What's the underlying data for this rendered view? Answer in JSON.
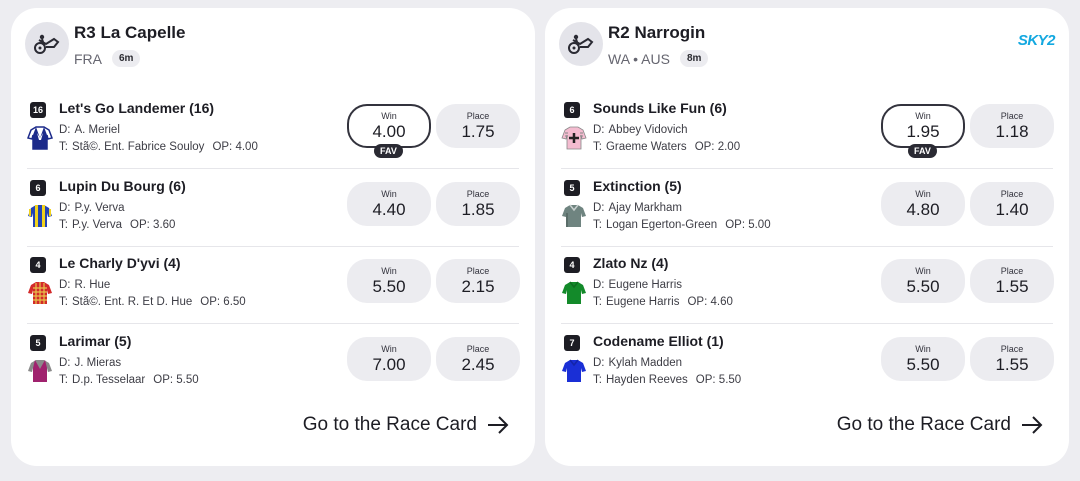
{
  "races": [
    {
      "title": "R3 La Capelle",
      "location": "FRA",
      "time_badge": "6m",
      "race_type_icon": "harness-racing-icon",
      "runners": [
        {
          "number": "16",
          "name": "Let's Go Landemer (16)",
          "driver_label": "D:",
          "driver": "A. Meriel",
          "trainer_label": "T:",
          "trainer": "Stã©. Ent. Fabrice Souloy",
          "op_label": "OP:",
          "op": "4.00",
          "win_label": "Win",
          "win": "4.00",
          "place_label": "Place",
          "place": "1.75",
          "favourite": true,
          "fav_label": "FAV",
          "silk_colors": [
            "#ffffff",
            "#1c2a8a"
          ]
        },
        {
          "number": "6",
          "name": "Lupin Du Bourg (6)",
          "driver_label": "D:",
          "driver": "P.y. Verva",
          "trainer_label": "T:",
          "trainer": "P.y. Verva",
          "op_label": "OP:",
          "op": "3.60",
          "win_label": "Win",
          "win": "4.40",
          "place_label": "Place",
          "place": "1.85",
          "favourite": false,
          "silk_colors": [
            "#2344b5",
            "#f1d21c"
          ]
        },
        {
          "number": "4",
          "name": "Le Charly D'yvi (4)",
          "driver_label": "D:",
          "driver": "R. Hue",
          "trainer_label": "T:",
          "trainer": "Stã©. Ent. R. Et D. Hue",
          "op_label": "OP:",
          "op": "6.50",
          "win_label": "Win",
          "win": "5.50",
          "place_label": "Place",
          "place": "2.15",
          "favourite": false,
          "silk_colors": [
            "#d32a2a",
            "#e7c34a"
          ]
        },
        {
          "number": "5",
          "name": "Larimar (5)",
          "driver_label": "D:",
          "driver": "J. Mieras",
          "trainer_label": "T:",
          "trainer": "D.p. Tesselaar",
          "op_label": "OP:",
          "op": "5.50",
          "win_label": "Win",
          "win": "7.00",
          "place_label": "Place",
          "place": "2.45",
          "favourite": false,
          "silk_colors": [
            "#8a8a8a",
            "#a0226e"
          ]
        }
      ],
      "race_card_link": "Go to the Race Card"
    },
    {
      "title": "R2 Narrogin",
      "location": "WA • AUS",
      "time_badge": "8m",
      "race_type_icon": "harness-racing-icon",
      "broadcaster": "SKY2",
      "runners": [
        {
          "number": "6",
          "name": "Sounds Like Fun (6)",
          "driver_label": "D:",
          "driver": "Abbey Vidovich",
          "trainer_label": "T:",
          "trainer": "Graeme Waters",
          "op_label": "OP:",
          "op": "2.00",
          "win_label": "Win",
          "win": "1.95",
          "place_label": "Place",
          "place": "1.18",
          "favourite": true,
          "fav_label": "FAV",
          "silk_colors": [
            "#f4bcd0",
            "#222222"
          ]
        },
        {
          "number": "5",
          "name": "Extinction (5)",
          "driver_label": "D:",
          "driver": "Ajay Markham",
          "trainer_label": "T:",
          "trainer": "Logan Egerton-Green",
          "op_label": "OP:",
          "op": "5.00",
          "win_label": "Win",
          "win": "4.80",
          "place_label": "Place",
          "place": "1.40",
          "favourite": false,
          "silk_colors": [
            "#6f8480",
            "#5a6d69"
          ]
        },
        {
          "number": "4",
          "name": "Zlato Nz (4)",
          "driver_label": "D:",
          "driver": "Eugene Harris",
          "trainer_label": "T:",
          "trainer": "Eugene Harris",
          "op_label": "OP:",
          "op": "4.60",
          "win_label": "Win",
          "win": "5.50",
          "place_label": "Place",
          "place": "1.55",
          "favourite": false,
          "silk_colors": [
            "#138a2a",
            "#0f6d21"
          ]
        },
        {
          "number": "7",
          "name": "Codename Elliot (1)",
          "driver_label": "D:",
          "driver": "Kylah Madden",
          "trainer_label": "T:",
          "trainer": "Hayden Reeves",
          "op_label": "OP:",
          "op": "5.50",
          "win_label": "Win",
          "win": "5.50",
          "place_label": "Place",
          "place": "1.55",
          "favourite": false,
          "silk_colors": [
            "#1a2fd6",
            "#1424a8"
          ]
        }
      ],
      "race_card_link": "Go to the Race Card"
    }
  ]
}
